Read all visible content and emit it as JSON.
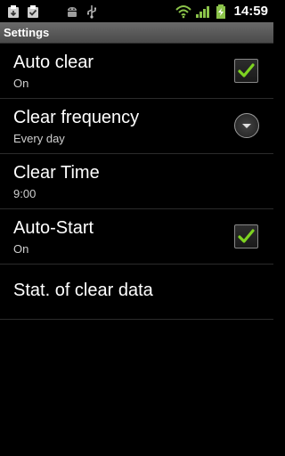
{
  "statusbar": {
    "time": "14:59",
    "icons_left": [
      "clipboard-icon",
      "clipboard-check-icon",
      "android-icon",
      "usb-icon"
    ],
    "icons_right": [
      "wifi-icon",
      "signal-icon",
      "battery-charging-icon"
    ]
  },
  "titlebar": {
    "title": "Settings"
  },
  "preferences": [
    {
      "title": "Auto clear",
      "summary": "On",
      "widget": "checkbox",
      "checked": true
    },
    {
      "title": "Clear frequency",
      "summary": "Every day",
      "widget": "dropdown"
    },
    {
      "title": "Clear Time",
      "summary": "9:00",
      "widget": "none"
    },
    {
      "title": "Auto-Start",
      "summary": "On",
      "widget": "checkbox",
      "checked": true
    },
    {
      "title": "Stat. of clear data",
      "widget": "none"
    }
  ],
  "colors": {
    "accent_check": "#7ed321",
    "title_bar": "#5a5a5a",
    "background": "#000000"
  }
}
